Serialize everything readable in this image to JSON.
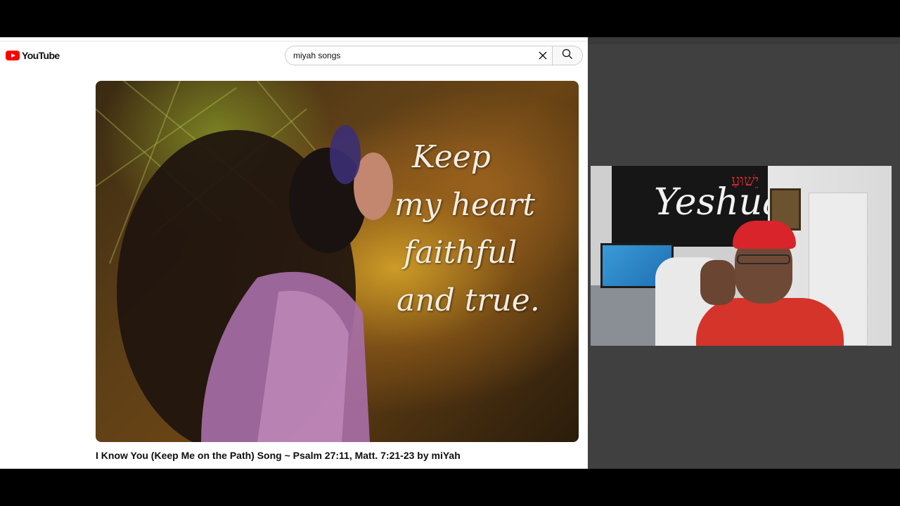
{
  "browser": {
    "logo_text": "YouTube",
    "search": {
      "query": "miyah songs"
    },
    "video": {
      "overlay_lines": [
        "Keep",
        "my heart",
        "faithful",
        "and true."
      ],
      "title": "I Know You (Keep Me on the Path) Song ~ Psalm 27:11, Matt. 7:21-23 by miYah"
    }
  },
  "webcam": {
    "banner_text": "Yeshua",
    "banner_hebrew": "יֵשׁוּעַ"
  },
  "colors": {
    "brand_red": "#ff0000",
    "pane_gray": "#404040"
  }
}
